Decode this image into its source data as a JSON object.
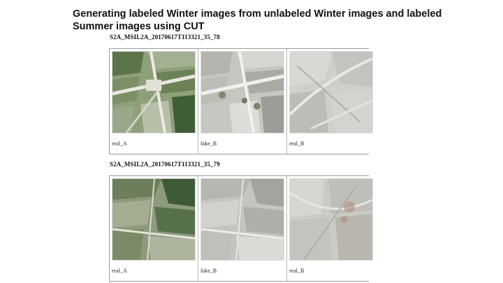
{
  "slide": {
    "title": "Generating labeled Winter images from unlabeled Winter images and labeled Summer images using CUT"
  },
  "rows": [
    {
      "label": "S2A_MSIL2A_20170617T113321_35_78",
      "images": [
        {
          "caption": "real_A",
          "style": "color"
        },
        {
          "caption": "fake_B",
          "style": "gray"
        },
        {
          "caption": "real_B",
          "style": "gray"
        }
      ]
    },
    {
      "label": "S2A_MSIL2A_20170617T113321_35_79",
      "images": [
        {
          "caption": "real_A",
          "style": "color"
        },
        {
          "caption": "fake_B",
          "style": "gray"
        },
        {
          "caption": "real_B",
          "style": "gray"
        }
      ]
    }
  ]
}
